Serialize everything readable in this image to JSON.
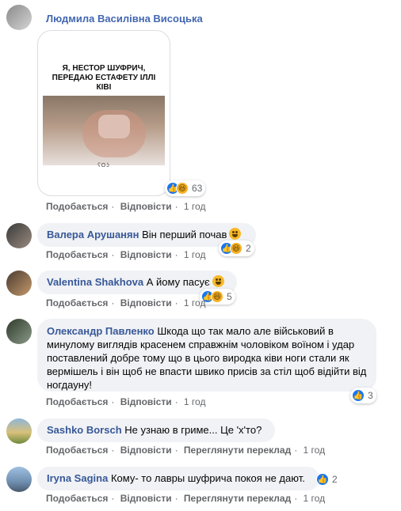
{
  "post": {
    "author": "Людмила Василівна Висоцька",
    "meme_text": "Я, НЕСТОР ШУФРИЧ, ПЕРЕДАЮ ЕСТАФЕТУ ІЛЛІ КІВІ",
    "meme_logo": "ʕOʖ",
    "reaction_count": "63",
    "actions": {
      "like": "Подобається",
      "reply": "Відповісти",
      "time": "1 год"
    }
  },
  "comments": [
    {
      "author": "Валера Арушанян",
      "text": "Він перший почав",
      "reaction_count": "2",
      "like": "Подобається",
      "reply": "Відповісти",
      "time": "1 год"
    },
    {
      "author": "Valentina Shakhova",
      "text": "А йому пасує",
      "reaction_count": "5",
      "like": "Подобається",
      "reply": "Відповісти",
      "time": "1 год"
    },
    {
      "author": "Олександр Павленко",
      "text": "Шкода що так мало але військовий в минулому виглядів красенем справжнім чоловіком воїном і удар поставлений добре тому що в цього виродка ківи ноги стали як вермішель і він щоб не впасти швико присів за стіл щоб відійти від ногдауну!",
      "reaction_count": "3",
      "like": "Подобається",
      "reply": "Відповісти",
      "time": "1 год"
    },
    {
      "author": "Sashko Borsch",
      "text": "Не узнаю в гриме... Це 'х'то?",
      "like": "Подобається",
      "reply": "Відповісти",
      "translate": "Переглянути переклад",
      "time": "1 год"
    },
    {
      "author": "Iryna Sagina",
      "text": "Кому- то лавры шуфрича покоя не дают.",
      "reaction_count": "2",
      "like": "Подобається",
      "reply": "Відповісти",
      "translate": "Переглянути переклад",
      "time": "1 год"
    }
  ]
}
